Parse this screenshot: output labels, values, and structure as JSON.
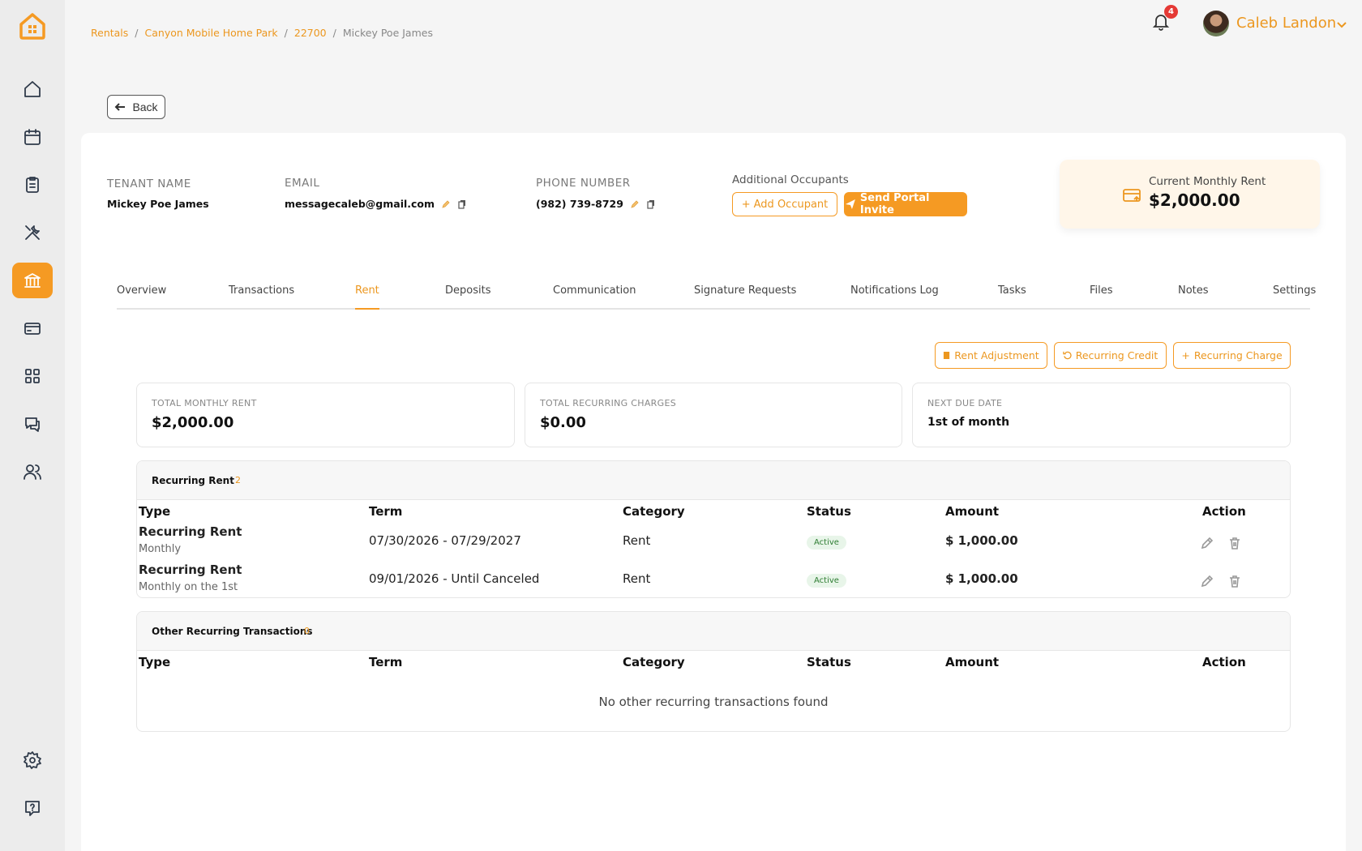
{
  "breadcrumb": {
    "items": [
      "Rentals",
      "Canyon Mobile Home Park",
      "22700",
      "Mickey Poe James"
    ],
    "separator": "/"
  },
  "header": {
    "notification_count": "4",
    "user_name": "Caleb Landon"
  },
  "back_label": "Back",
  "tenant": {
    "name_label": "TENANT NAME",
    "name": "Mickey Poe James",
    "email_label": "EMAIL",
    "email": "messagecaleb@gmail.com",
    "phone_label": "PHONE NUMBER",
    "phone": "(982) 739-8729",
    "occupants_label": "Additional Occupants",
    "add_occupant_label": "Add Occupant",
    "send_invite_label": "Send Portal Invite"
  },
  "rent_card": {
    "label": "Current Monthly Rent",
    "value": "$2,000.00"
  },
  "tabs": [
    "Overview",
    "Transactions",
    "Rent",
    "Deposits",
    "Communication",
    "Signature Requests",
    "Notifications Log",
    "Tasks",
    "Files",
    "Notes",
    "Settings"
  ],
  "active_tab": "Rent",
  "actions": {
    "rent_adjustment": "Rent Adjustment",
    "recurring_credit": "Recurring Credit",
    "recurring_charge": "Recurring Charge"
  },
  "stats": {
    "total_monthly_rent_label": "TOTAL MONTHLY RENT",
    "total_monthly_rent": "$2,000.00",
    "total_recurring_label": "TOTAL RECURRING CHARGES",
    "total_recurring": "$0.00",
    "next_due_label": "NEXT DUE DATE",
    "next_due": "1st of month"
  },
  "columns": {
    "type": "Type",
    "term": "Term",
    "category": "Category",
    "status": "Status",
    "amount": "Amount",
    "action": "Action"
  },
  "recurring_rent": {
    "title": "Recurring Rent",
    "count": "2",
    "rows": [
      {
        "type": "Recurring Rent",
        "frequency": "Monthly",
        "term": "07/30/2026 - 07/29/2027",
        "category": "Rent",
        "status": "Active",
        "amount": "$ 1,000.00"
      },
      {
        "type": "Recurring Rent",
        "frequency": "Monthly on the 1st",
        "term": "09/01/2026 - Until Canceled",
        "category": "Rent",
        "status": "Active",
        "amount": "$ 1,000.00"
      }
    ]
  },
  "other_recurring": {
    "title": "Other Recurring Transactions",
    "count": "0",
    "empty_message": "No other recurring transactions found"
  },
  "colors": {
    "accent": "#f59a23",
    "accent_text": "#ec971f",
    "active_badge": "#2e7d32"
  }
}
